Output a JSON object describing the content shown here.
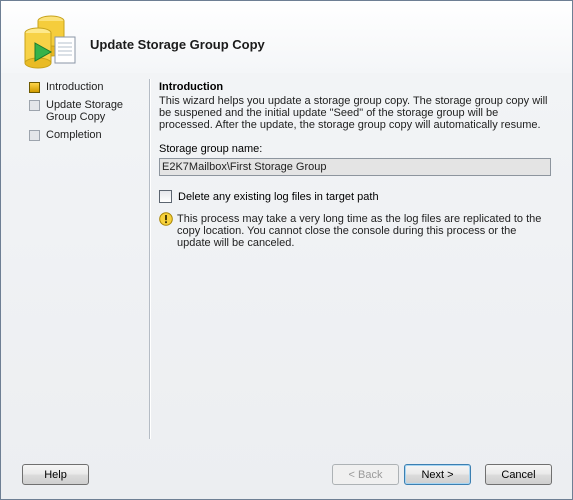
{
  "window": {
    "title": "Update Storage Group Copy"
  },
  "nav": {
    "items": [
      {
        "label": "Introduction",
        "active": true
      },
      {
        "label": "Update Storage Group Copy",
        "active": false
      },
      {
        "label": "Completion",
        "active": false
      }
    ]
  },
  "main": {
    "section_title": "Introduction",
    "description": "This wizard helps you update a storage group copy. The storage group copy will be suspened and the initial update \"Seed\" of the storage group will be processed. After the update, the storage group copy will automatically resume.",
    "storage_group_label": "Storage group name:",
    "storage_group_value": "E2K7Mailbox\\First Storage Group",
    "checkbox_label": "Delete any existing log files in target path",
    "checkbox_checked": false,
    "warning_text": "This process may take a very long time as the log files are replicated to the copy location. You cannot close the console during this process or the update will be canceled."
  },
  "buttons": {
    "help": "Help",
    "back": "< Back",
    "next": "Next >",
    "cancel": "Cancel"
  },
  "icons": {
    "header": "storage-group-copy-icon",
    "warning": "warning-icon"
  }
}
